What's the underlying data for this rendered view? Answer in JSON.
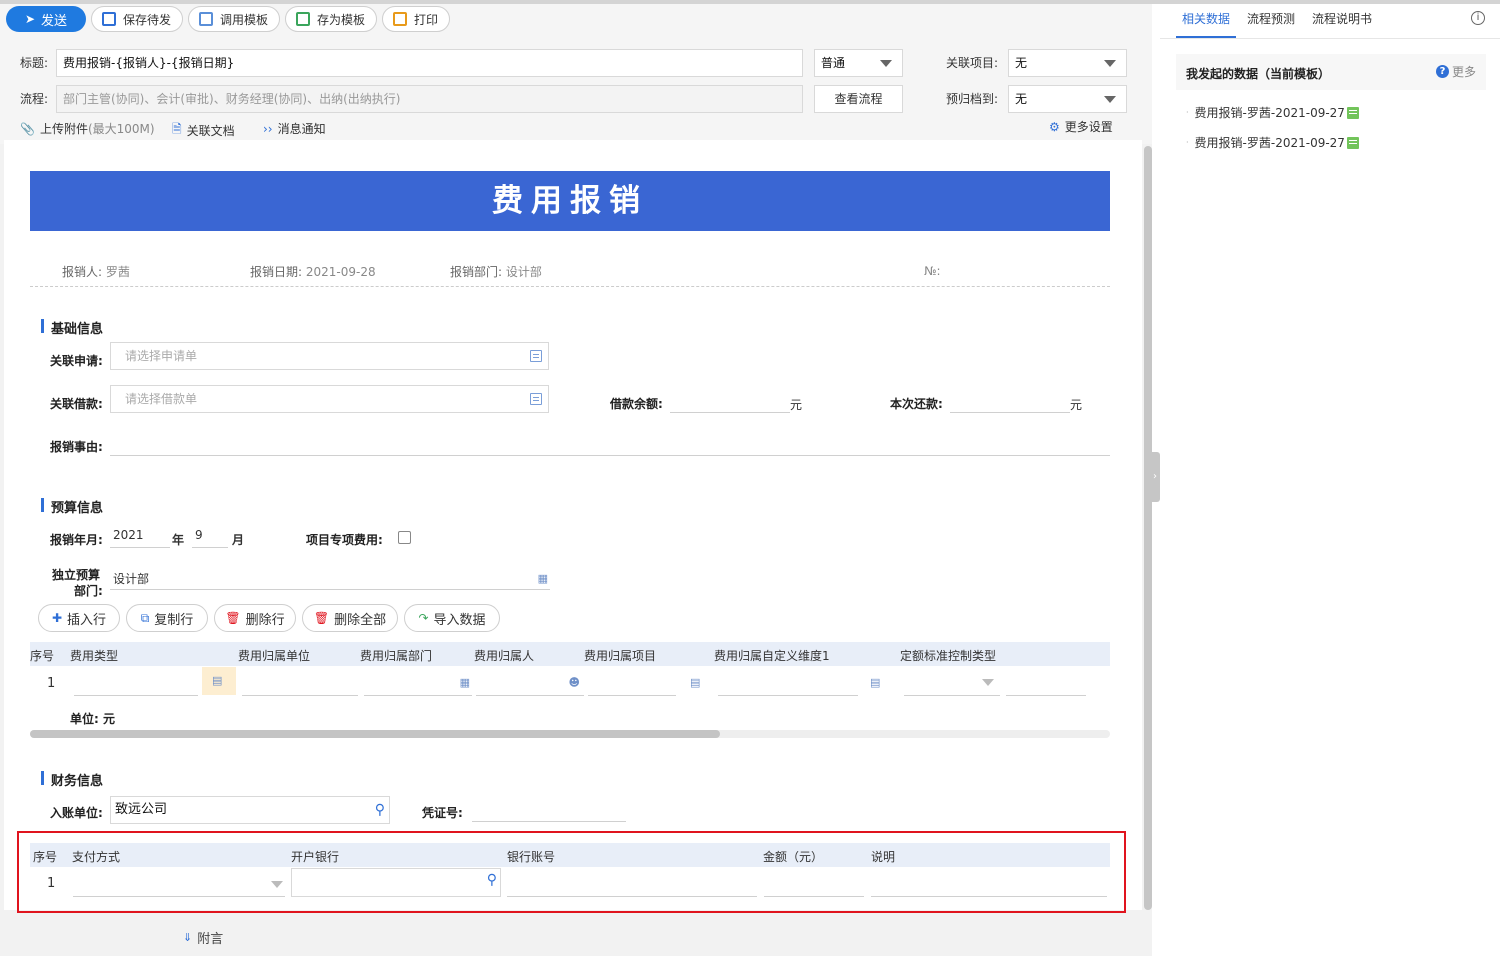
{
  "toolbar": {
    "send": "发送",
    "save_draft": "保存待发",
    "apply_template": "调用模板",
    "save_template": "存为模板",
    "print": "打印"
  },
  "header": {
    "title_label": "标题:",
    "title_value": "费用报销-{报销人}-{报销日期}",
    "priority_value": "普通",
    "related_project_label": "关联项目:",
    "related_project_value": "无",
    "flow_label": "流程:",
    "flow_value": "部门主管(协同)、会计(审批)、财务经理(协同)、出纳(出纳执行)",
    "view_flow": "查看流程",
    "archive_label": "预归档到:",
    "archive_value": "无",
    "upload": "上传附件",
    "upload_limit": "(最大100M)",
    "related_doc": "关联文档",
    "notify": "消息通知",
    "more_settings": "更多设置"
  },
  "form": {
    "banner": "费用报销",
    "meta": {
      "applicant_label": "报销人:",
      "applicant": "罗茜",
      "date_label": "报销日期:",
      "date": "2021-09-28",
      "dept_label": "报销部门:",
      "dept": "设计部",
      "no_label": "№:"
    },
    "basic": {
      "title": "基础信息",
      "related_apply_label": "关联申请:",
      "related_apply_placeholder": "请选择申请单",
      "related_loan_label": "关联借款:",
      "related_loan_placeholder": "请选择借款单",
      "loan_balance_label": "借款余额:",
      "repay_label": "本次还款:",
      "yuan": "元",
      "reason_label": "报销事由:"
    },
    "budget": {
      "title": "预算信息",
      "ym_label": "报销年月:",
      "year": "2021",
      "year_unit": "年",
      "month": "9",
      "month_unit": "月",
      "project_fee_label": "项目专项费用:",
      "dept_label_1": "独立预算",
      "dept_label_2": "部门:",
      "dept_value": "设计部"
    },
    "actions": {
      "insert": "插入行",
      "copy": "复制行",
      "delete": "删除行",
      "delete_all": "删除全部",
      "import": "导入数据"
    },
    "detail_table": {
      "headers": [
        "序号",
        "费用类型",
        "费用归属单位",
        "费用归属部门",
        "费用归属人",
        "费用归属项目",
        "费用归属自定义维度1",
        "定额标准控制类型"
      ],
      "row_no": "1",
      "unit_label": "单位: 元"
    },
    "finance": {
      "title": "财务信息",
      "entry_label": "入账单位:",
      "entry_value": "致远公司",
      "voucher_label": "凭证号:"
    },
    "payment_table": {
      "headers": [
        "序号",
        "支付方式",
        "开户银行",
        "银行账号",
        "金额（元）",
        "说明"
      ],
      "row_no": "1"
    },
    "attachment_note": "附言"
  },
  "right_panel": {
    "tabs": [
      "相关数据",
      "流程预测",
      "流程说明书"
    ],
    "info": "i",
    "section_title": "我发起的数据（当前模板）",
    "more": "更多",
    "items": [
      "费用报销-罗茜-2021-09-27",
      "费用报销-罗茜-2021-09-27"
    ]
  }
}
